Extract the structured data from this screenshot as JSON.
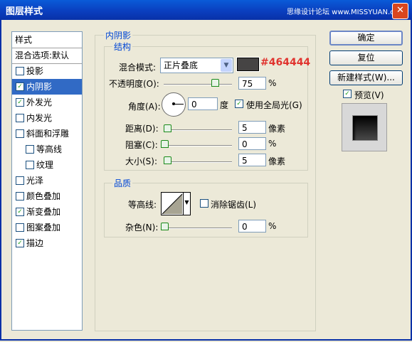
{
  "window": {
    "title": "图层样式",
    "watermark": "思缘设计论坛 www.MISSYUAN.com",
    "close": "✕"
  },
  "sidebar": {
    "items": [
      {
        "label": "样式",
        "checkbox": false
      },
      {
        "label": "混合选项:默认",
        "checkbox": false
      },
      {
        "label": "投影",
        "checkbox": true,
        "checked": false
      },
      {
        "label": "内阴影",
        "checkbox": true,
        "checked": true,
        "selected": true
      },
      {
        "label": "外发光",
        "checkbox": true,
        "checked": true
      },
      {
        "label": "内发光",
        "checkbox": true,
        "checked": false
      },
      {
        "label": "斜面和浮雕",
        "checkbox": true,
        "checked": false
      },
      {
        "label": "等高线",
        "checkbox": true,
        "checked": false,
        "indent": true
      },
      {
        "label": "纹理",
        "checkbox": true,
        "checked": false,
        "indent": true
      },
      {
        "label": "光泽",
        "checkbox": true,
        "checked": false
      },
      {
        "label": "颜色叠加",
        "checkbox": true,
        "checked": false
      },
      {
        "label": "渐变叠加",
        "checkbox": true,
        "checked": true
      },
      {
        "label": "图案叠加",
        "checkbox": true,
        "checked": false
      },
      {
        "label": "描边",
        "checkbox": true,
        "checked": true
      }
    ]
  },
  "inner_shadow": {
    "section_title": "内阴影",
    "structure_title": "结构",
    "blend_mode_label": "混合模式:",
    "blend_mode_value": "正片叠底",
    "color_hex": "#464444",
    "color_label": "#464444",
    "opacity_label": "不透明度(O):",
    "opacity_value": "75",
    "opacity_unit": "%",
    "opacity_fraction": 0.75,
    "angle_label": "角度(A):",
    "angle_value": "0",
    "angle_unit": "度",
    "global_light_label": "使用全局光(G)",
    "global_light_checked": true,
    "distance_label": "距离(D):",
    "distance_value": "5",
    "distance_unit": "像素",
    "choke_label": "阻塞(C):",
    "choke_value": "0",
    "choke_unit": "%",
    "size_label": "大小(S):",
    "size_value": "5",
    "size_unit": "像素"
  },
  "quality": {
    "title": "品质",
    "contour_label": "等高线:",
    "antialias_label": "消除锯齿(L)",
    "antialias_checked": false,
    "noise_label": "杂色(N):",
    "noise_value": "0",
    "noise_unit": "%"
  },
  "buttons": {
    "ok": "确定",
    "reset": "复位",
    "new_style": "新建样式(W)...",
    "preview_label": "预览(V)",
    "preview_checked": true
  }
}
